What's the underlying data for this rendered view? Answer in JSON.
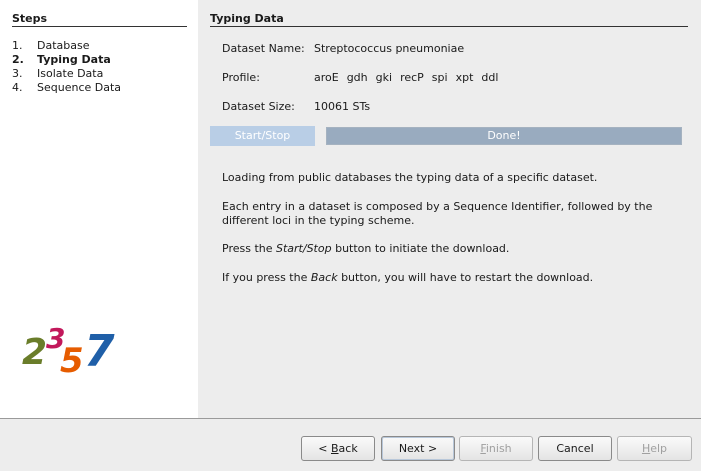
{
  "sidebar": {
    "title": "Steps",
    "steps": [
      {
        "num": "1.",
        "label": "Database"
      },
      {
        "num": "2.",
        "label": "Typing Data"
      },
      {
        "num": "3.",
        "label": "Isolate Data"
      },
      {
        "num": "4.",
        "label": "Sequence Data"
      }
    ],
    "active_step": 2,
    "logo": {
      "text": "2357",
      "colors": [
        "#6a7d2a",
        "#c2185b",
        "#e65c00",
        "#1f5fa8"
      ]
    }
  },
  "main": {
    "title": "Typing Data",
    "dataset_name_label": "Dataset Name:",
    "dataset_name_value": "Streptococcus pneumoniae",
    "profile_label": "Profile:",
    "profile_loci": [
      "aroE",
      "gdh",
      "gki",
      "recP",
      "spi",
      "xpt",
      "ddl"
    ],
    "dataset_size_label": "Dataset Size:",
    "dataset_size_value": "10061 STs",
    "start_stop_label": "Start/Stop",
    "progress": {
      "text": "Done!",
      "fraction": 1.0
    },
    "description": {
      "p1": "Loading from public databases the typing data of a specific dataset.",
      "p2": "Each entry in a dataset is composed by a Sequence Identifier, followed by the different loci in the typing scheme.",
      "p3_pre": "Press the ",
      "p3_em": "Start/Stop",
      "p3_post": " button to initiate the download.",
      "p4_pre": "If you press the ",
      "p4_em": "Back",
      "p4_post": " button, you will have to restart the download."
    }
  },
  "buttons": {
    "back": {
      "pre": "< ",
      "mnemonic": "B",
      "post": "ack"
    },
    "next": "Next >",
    "finish": {
      "mnemonic": "F",
      "post": "inish"
    },
    "cancel": "Cancel",
    "help": {
      "mnemonic": "H",
      "post": "elp"
    }
  },
  "colors": {
    "start_stop_bg": "#b9cee6",
    "progress_fill": "#99abbf"
  }
}
